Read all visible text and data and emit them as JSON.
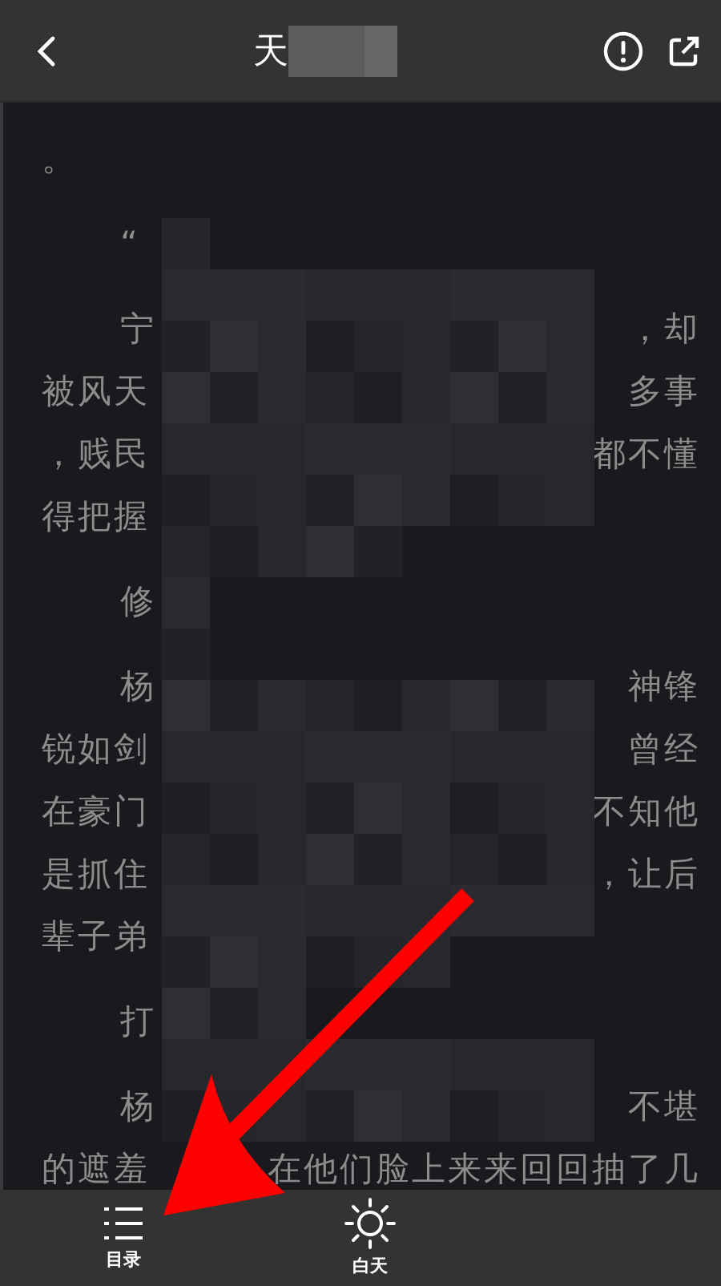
{
  "header": {
    "title": "天"
  },
  "paragraphs": [
    {
      "kind": "continuation",
      "lines": [
        {
          "left": "。"
        }
      ]
    },
    {
      "kind": "paragraph",
      "lines": [
        {
          "left": "“"
        }
      ]
    },
    {
      "kind": "paragraph",
      "lines": [
        {
          "left": "宁",
          "right": "，却"
        },
        {
          "left": "被风天",
          "right": "多事"
        },
        {
          "left": "，贱民",
          "right": "都不懂"
        },
        {
          "left": "得把握"
        }
      ]
    },
    {
      "kind": "paragraph",
      "lines": [
        {
          "left": "修"
        }
      ]
    },
    {
      "kind": "paragraph",
      "lines": [
        {
          "left": "杨",
          "right": "神锋"
        },
        {
          "left": "锐如剑",
          "right": "曾经"
        },
        {
          "left": "在豪门",
          "right": "不知他"
        },
        {
          "left": "是抓住",
          "right": "，让后"
        },
        {
          "left": "辈子弟"
        }
      ]
    },
    {
      "kind": "paragraph",
      "lines": [
        {
          "left": "打"
        }
      ]
    },
    {
      "kind": "paragraph",
      "lines": [
        {
          "left": "杨",
          "right": "不堪"
        },
        {
          "left": "的遮羞",
          "right": "在他们脸上来来回回抽了几"
        }
      ]
    }
  ],
  "toolbar": [
    {
      "kind": "contents",
      "label": "目录"
    },
    {
      "kind": "daylight",
      "label": "白天"
    }
  ]
}
